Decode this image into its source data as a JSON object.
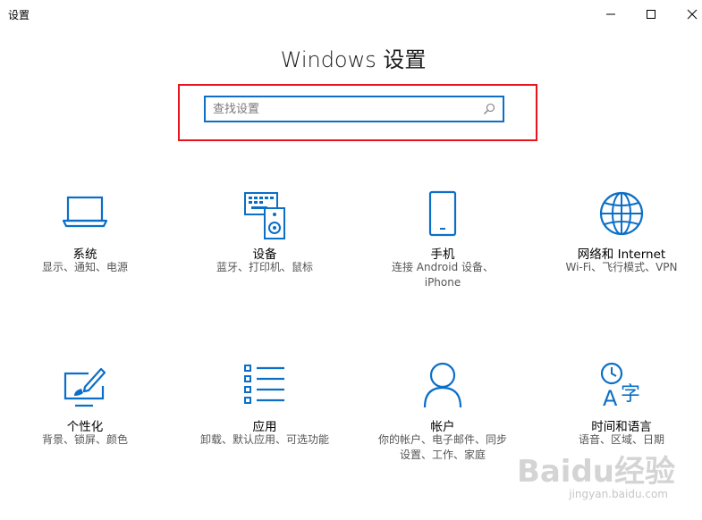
{
  "window": {
    "title": "设置",
    "controls": [
      "minimize",
      "maximize",
      "close"
    ]
  },
  "header": {
    "title": "Windows 设置"
  },
  "search": {
    "placeholder": "查找设置",
    "value": ""
  },
  "colors": {
    "accent": "#0b6fc7",
    "highlight": "#e8141e"
  },
  "tiles": [
    {
      "icon": "laptop-icon",
      "label": "系统",
      "desc": "显示、通知、电源"
    },
    {
      "icon": "devices-icon",
      "label": "设备",
      "desc": "蓝牙、打印机、鼠标"
    },
    {
      "icon": "phone-icon",
      "label": "手机",
      "desc": "连接 Android 设备、\niPhone"
    },
    {
      "icon": "globe-icon",
      "label": "网络和 Internet",
      "desc": "Wi-Fi、飞行模式、VPN"
    },
    {
      "icon": "personalization-icon",
      "label": "个性化",
      "desc": "背景、锁屏、颜色"
    },
    {
      "icon": "apps-icon",
      "label": "应用",
      "desc": "卸载、默认应用、可选功能"
    },
    {
      "icon": "account-icon",
      "label": "帐户",
      "desc": "你的帐户、电子邮件、同步\n设置、工作、家庭"
    },
    {
      "icon": "time-language-icon",
      "label": "时间和语言",
      "desc": "语音、区域、日期"
    }
  ],
  "watermark": {
    "brand": "Baidu经验",
    "url": "jingyan.baidu.com"
  }
}
